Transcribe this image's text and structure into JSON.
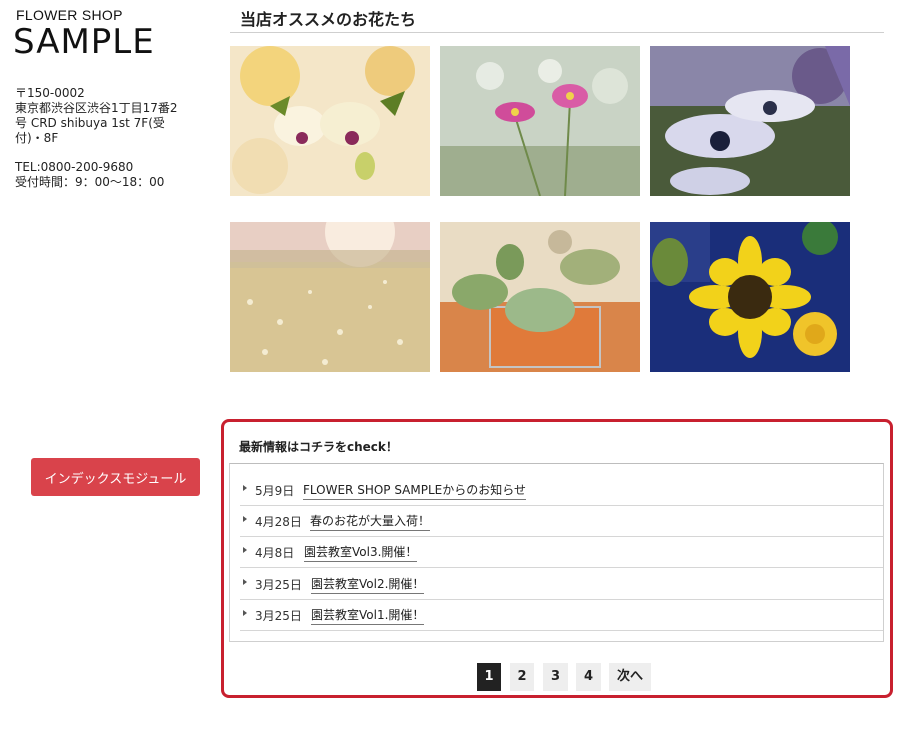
{
  "sidebar": {
    "logo_small": "FLOWER SHOP",
    "logo_big": "SAMPLE",
    "address_lines": [
      "〒150-0002",
      "東京都渋谷区渋谷1丁目17番2",
      "号 CRD shibuya 1st 7F(受",
      "付)・8F"
    ],
    "tel": "TEL:0800-200-9680",
    "hours": "受付時間：9：00〜18：00",
    "index_button": "インデックスモジュール"
  },
  "main": {
    "title": "当店オススメのお花たち",
    "photos": [
      {
        "name": "orchid-photo"
      },
      {
        "name": "cosmos-photo"
      },
      {
        "name": "daisy-photo"
      },
      {
        "name": "field-photo"
      },
      {
        "name": "succulent-photo"
      },
      {
        "name": "sunflower-photo"
      }
    ]
  },
  "news": {
    "title": "最新情報はコチラをcheck！",
    "items": [
      {
        "date": "5月9日",
        "text": "FLOWER SHOP SAMPLEからのお知らせ"
      },
      {
        "date": "4月28日",
        "text": "春のお花が大量入荷！"
      },
      {
        "date": "4月8日",
        "text": "園芸教室Vol3.開催！"
      },
      {
        "date": "3月25日",
        "text": "園芸教室Vol2.開催！"
      },
      {
        "date": "3月25日",
        "text": "園芸教室Vol1.開催！"
      }
    ],
    "pagination": {
      "pages": [
        "1",
        "2",
        "3",
        "4"
      ],
      "current": "1",
      "next": "次へ"
    }
  },
  "colors": {
    "accent_red": "#d9434b",
    "news_border": "#c8202f",
    "pager_active": "#222222"
  }
}
